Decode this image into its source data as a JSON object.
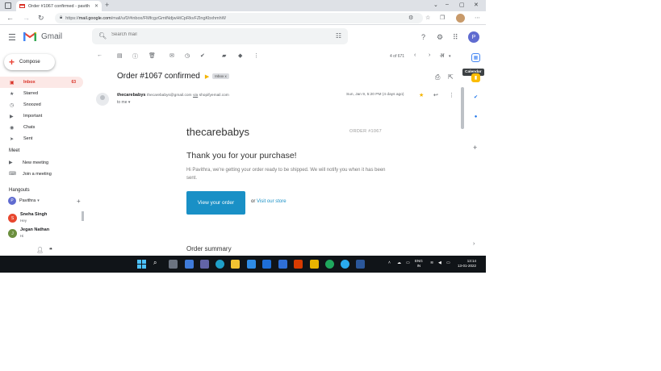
{
  "browser": {
    "tab_title": "Order #1067 confirmed - pavith",
    "tab_close": "✕",
    "new_tab": "+",
    "url_prefix": "https://",
    "url_host": "mail.google.com",
    "url_path": "/mail/u/0/#inbox/FMfcgzGmtNdjwHtCpRkvFZlngKbxhmhW",
    "window_controls": [
      "⌄",
      "–",
      "▢",
      "✕"
    ]
  },
  "gmail": {
    "wordmark": "Gmail",
    "search_placeholder": "Search mail"
  },
  "sidebar": {
    "compose_label": "Compose",
    "items": [
      {
        "label": "Inbox",
        "count": "63",
        "icon": "inbox-icon",
        "active": true
      },
      {
        "label": "Starred",
        "count": "",
        "icon": "star-icon",
        "active": false
      },
      {
        "label": "Snoozed",
        "count": "",
        "icon": "clock-icon",
        "active": false
      },
      {
        "label": "Important",
        "count": "",
        "icon": "important-icon",
        "active": false
      },
      {
        "label": "Chats",
        "count": "",
        "icon": "chat-icon",
        "active": false
      },
      {
        "label": "Sent",
        "count": "",
        "icon": "send-icon",
        "active": false
      }
    ],
    "meet_title": "Meet",
    "meet_items": [
      "New meeting",
      "Join a meeting"
    ],
    "hangouts_title": "Hangouts",
    "hangouts_user": "Pavithra",
    "hangouts_user_initial": "P",
    "contacts": [
      {
        "name": "Sneha Singh",
        "status": "Hey",
        "initial": "S",
        "color": "#e8472f"
      },
      {
        "name": "Jegan Nathan",
        "status": "Hi",
        "initial": "J",
        "color": "#6b8f3e"
      }
    ]
  },
  "toolbar": {
    "pager": "4 of 671",
    "input_tools": "अ"
  },
  "message": {
    "subject": "Order #1067 confirmed",
    "label": "Inbox",
    "label_remove": "x",
    "sender_name": "thecarebabys",
    "sender_address": "thecarebabys@gmail.com",
    "via_word": "via",
    "via_domain": "shopifyemail.com",
    "to_line": "to me",
    "date": "Sun, Jan 9, 5:20 PM (4 days ago)"
  },
  "email_body": {
    "shop_name": "thecarebabys",
    "order_number": "ORDER #1067",
    "heading": "Thank you for your purchase!",
    "text": "Hi Pavithra, we're getting your order ready to be shipped. We will notify you when it has been sent.",
    "button": "View your order",
    "or_text": "or",
    "visit_link": "Visit our store",
    "summary_heading": "Order summary"
  },
  "right_panel": {
    "tooltip": "Calendar"
  },
  "taskbar": {
    "lang_line1": "ENG",
    "lang_line2": "IN",
    "time": "13:14",
    "date": "13-01-2022"
  },
  "colors": {
    "accent_red": "#d93025",
    "shopify_blue": "#1990c6",
    "inbox_highlight": "#fce8e6"
  }
}
